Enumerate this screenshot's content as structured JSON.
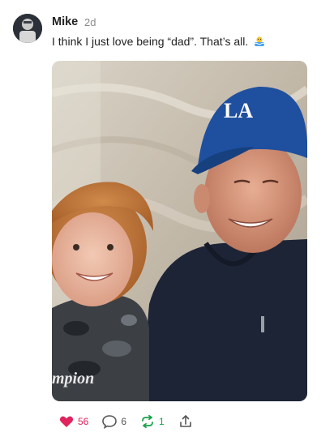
{
  "post": {
    "author": "Mike",
    "time": "2d",
    "text": "I think I just love being “dad”. That’s all.",
    "emoji": "person-in-water-emoji",
    "photo": {
      "description_icon": "photo-father-son-selfie",
      "cap_logo_text": "LA",
      "shirt_text": "mpion"
    }
  },
  "actions": {
    "like_count": "56",
    "comment_count": "6",
    "repost_count": "1"
  },
  "colors": {
    "like": "#e0245e",
    "repost": "#17a34a",
    "muted": "#8a8a8a"
  }
}
